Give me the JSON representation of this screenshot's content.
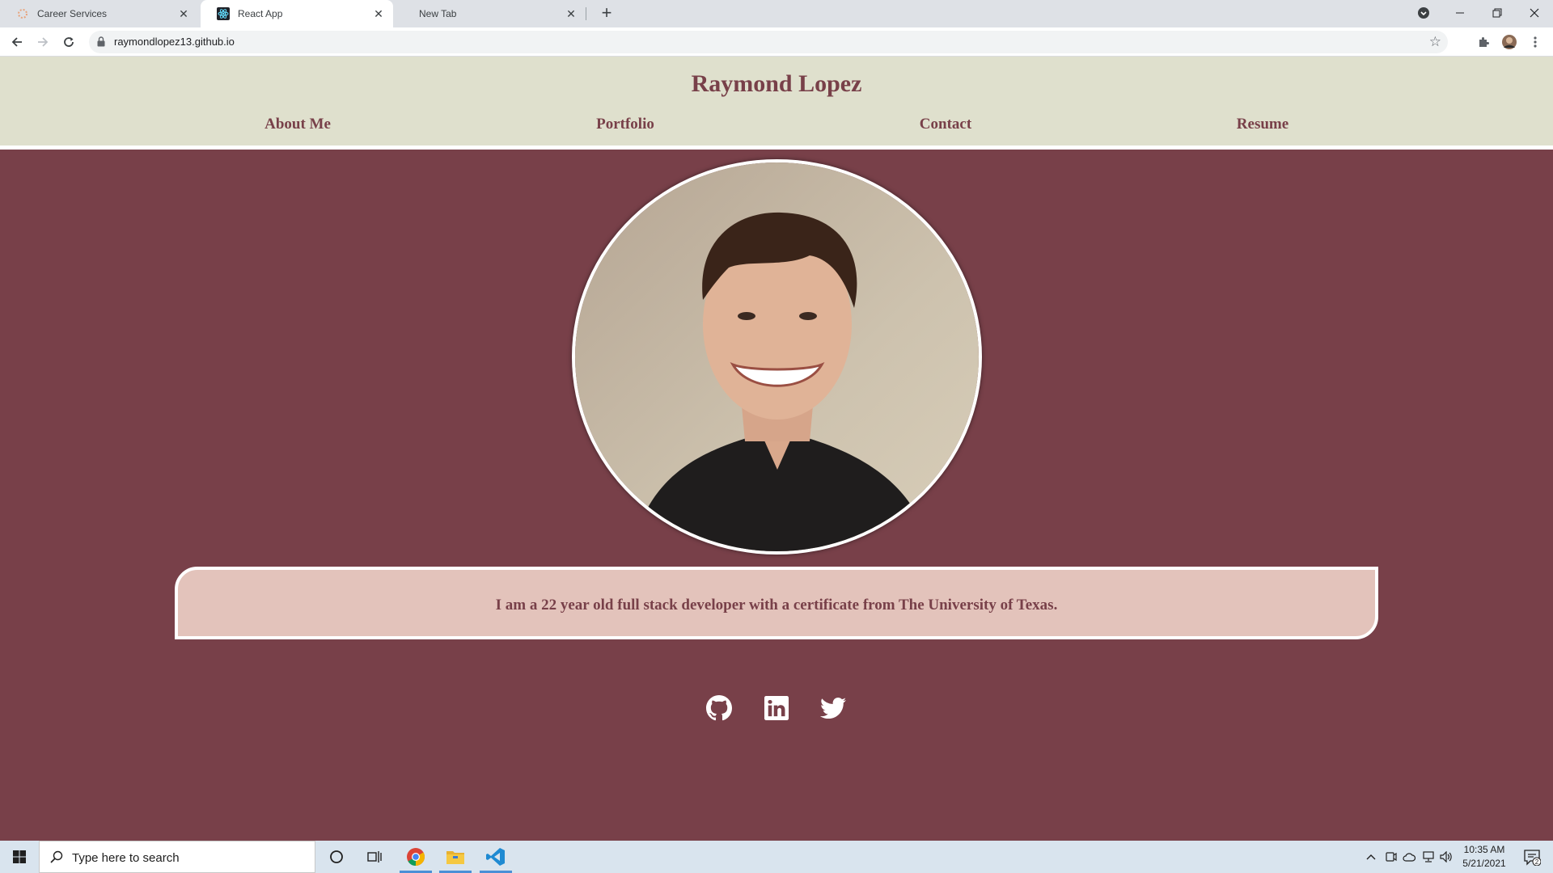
{
  "browser": {
    "tabs": [
      {
        "title": "Career Services",
        "active": false
      },
      {
        "title": "React App",
        "active": true
      },
      {
        "title": "New Tab",
        "active": false
      }
    ],
    "url": "raymondlopez13.github.io"
  },
  "site": {
    "title": "Raymond Lopez",
    "nav": [
      "About Me",
      "Portfolio",
      "Contact",
      "Resume"
    ],
    "bio": "I am a 22 year old full stack developer with a certificate from The University of Texas.",
    "social": [
      "github-icon",
      "linkedin-icon",
      "twitter-icon"
    ],
    "colors": {
      "primary": "#784049",
      "header_bg": "#dfe0cd",
      "bio_bg": "#e3c3bb"
    }
  },
  "taskbar": {
    "search_placeholder": "Type here to search",
    "time": "10:35 AM",
    "date": "5/21/2021",
    "notifications": "2"
  }
}
